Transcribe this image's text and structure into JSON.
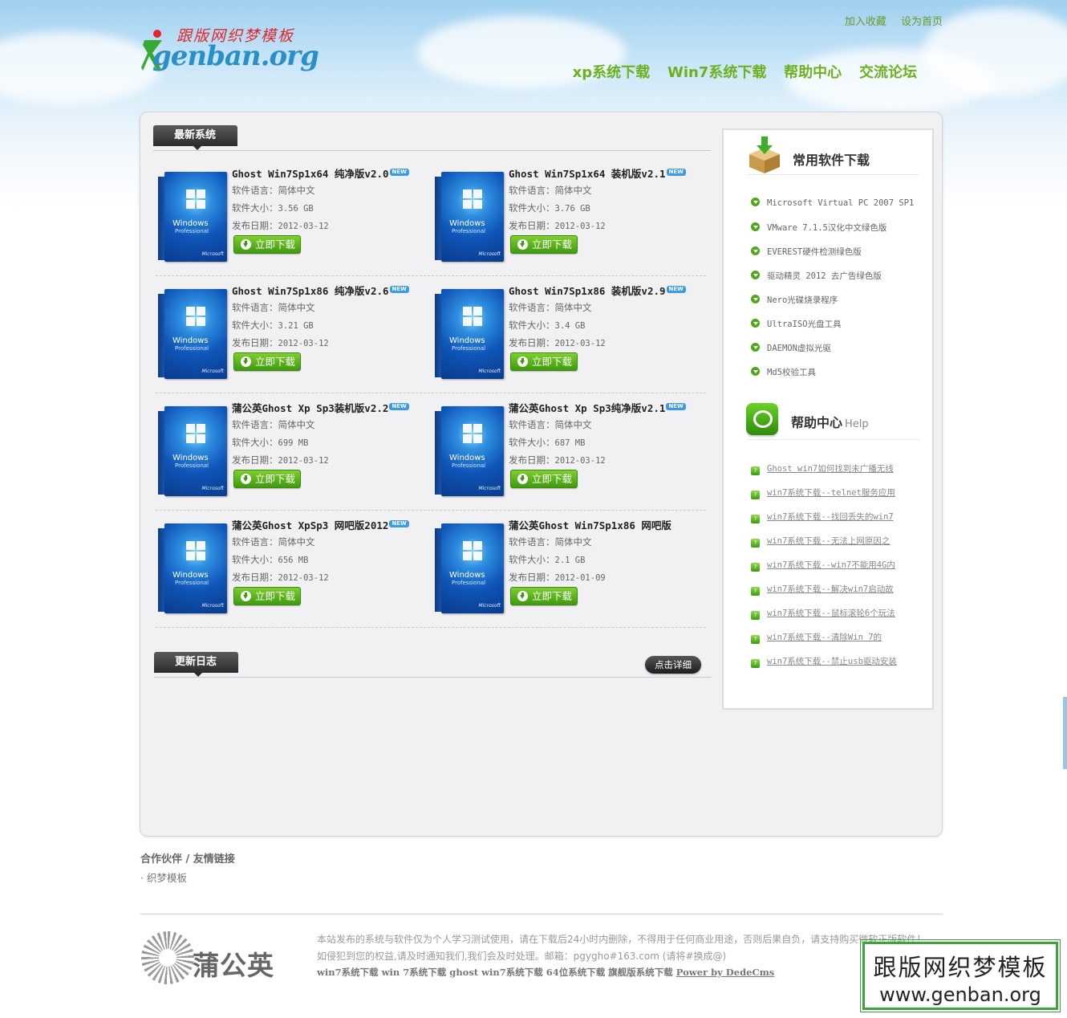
{
  "header": {
    "logo_script": "跟版网织梦模板",
    "logo_word": "genban.org",
    "top_links": [
      "加入收藏",
      "设为首页"
    ],
    "nav": [
      "xp系统下载",
      "Win7系统下载",
      "帮助中心",
      "交流论坛"
    ]
  },
  "sections": {
    "latest_title": "最新系统",
    "updates_title": "更新日志",
    "more_button": "点击详细"
  },
  "labels": {
    "lang": "软件语言：",
    "size": "软件大小：",
    "date": "发布日期：",
    "download": "立即下载",
    "new_badge": "NEW",
    "box_brand": "Windows",
    "box_edition": "Professional",
    "box_maker": "Microsoft"
  },
  "items": [
    {
      "title": "Ghost Win7Sp1x64 纯净版v2.0",
      "new": true,
      "lang": "简体中文",
      "size": "3.56 GB",
      "date": "2012-03-12"
    },
    {
      "title": "Ghost Win7Sp1x64 装机版v2.1",
      "new": true,
      "lang": "简体中文",
      "size": "3.76 GB",
      "date": "2012-03-12"
    },
    {
      "title": "Ghost Win7Sp1x86 纯净版v2.6",
      "new": true,
      "lang": "简体中文",
      "size": "3.21 GB",
      "date": "2012-03-12"
    },
    {
      "title": "Ghost Win7Sp1x86 装机版v2.9",
      "new": true,
      "lang": "简体中文",
      "size": "3.4 GB",
      "date": "2012-03-12"
    },
    {
      "title": "蒲公英Ghost Xp Sp3装机版v2.2",
      "new": true,
      "lang": "简体中文",
      "size": "699 MB",
      "date": "2012-03-12"
    },
    {
      "title": "蒲公英Ghost Xp Sp3纯净版v2.1",
      "new": true,
      "lang": "简体中文",
      "size": "687 MB",
      "date": "2012-03-12"
    },
    {
      "title": "蒲公英Ghost XpSp3 网吧版2012",
      "new": true,
      "lang": "简体中文",
      "size": "656 MB",
      "date": "2012-03-12"
    },
    {
      "title": "蒲公英Ghost Win7Sp1x86 网吧版",
      "new": false,
      "lang": "简体中文",
      "size": "2.1 GB",
      "date": "2012-01-09"
    }
  ],
  "sidebar": {
    "software_title": "常用软件下载",
    "software": [
      "Microsoft Virtual PC 2007 SP1",
      "VMware 7.1.5汉化中文绿色版",
      "EVEREST硬件检测绿色版",
      "驱动精灵 2012 去广告绿色版",
      "Nero光碟烧录程序",
      "UltraISO光盘工具",
      "DAEMON虚拟光驱",
      "Md5校验工具"
    ],
    "help_title": "帮助中心",
    "help_sub": "Help",
    "help": [
      "Ghost win7如何找到未广播无线",
      "win7系统下载--telnet服务应用",
      "win7系统下载--找回丢失的win7",
      "win7系统下载--无法上网原因之",
      "win7系统下载--win7不能用4G内",
      "win7系统下载--解决win7启动故",
      "win7系统下载--鼠标滚轮6个玩法",
      "win7系统下载--清除Win 7的",
      "win7系统下载--禁止usb驱动安装"
    ]
  },
  "links": {
    "title": "合作伙伴 / 友情链接",
    "item": "织梦模板"
  },
  "footer": {
    "logo_name": "蒲公英",
    "line1": "本站发布的系统与软件仅为个人学习测试使用，请在下载后24小时内删除，不得用于任何商业用途，否则后果自负，请支持购买微软正版软件！",
    "line2": "如侵犯到您的权益,请及时通知我们,我们会及时处理。邮箱：pgygho#163.com (请将#换成@)",
    "line3": "win7系统下载 win 7系统下载 ghost win7系统下载 64位系统下载 旗舰版系统下载",
    "power": "Power by DedeCms"
  },
  "watermark": {
    "line1": "跟版网织梦模板",
    "line2": "www.genban.org"
  },
  "colors": {
    "nav_green": "#6cb120",
    "download_green": "#4ea81a",
    "watermark_border": "#3ba43b"
  }
}
